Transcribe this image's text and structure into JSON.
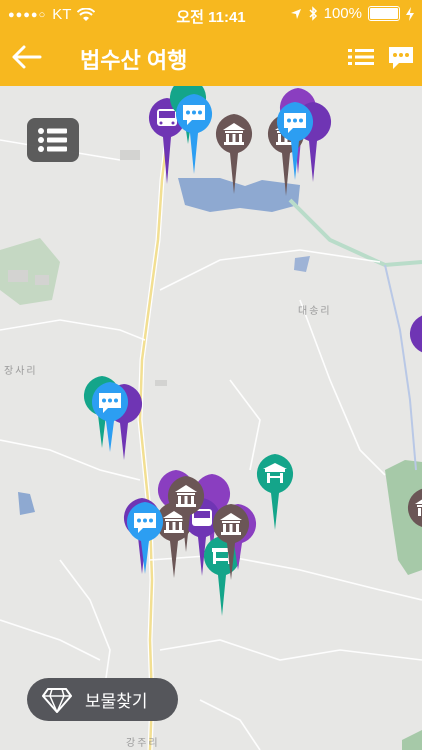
{
  "status_bar": {
    "carrier": "KT",
    "time": "오전 11:41",
    "battery": "100%"
  },
  "header": {
    "title": "법수산 여행"
  },
  "map": {
    "labels": [
      "대송리",
      "장사리",
      "강주리"
    ]
  },
  "treasure_button": {
    "label": "보물찾기"
  },
  "colors": {
    "bar": "#f7b81f",
    "pin_purple": "#6f35b4",
    "pin_blue": "#2c9ef2",
    "pin_brown": "#6b5656",
    "pin_green": "#14a58a"
  },
  "icons": [
    "back-arrow-icon",
    "list-icon",
    "chat-icon",
    "bus-icon",
    "museum-icon",
    "pavilion-icon",
    "speech-bubble-icon",
    "diamond-icon"
  ]
}
